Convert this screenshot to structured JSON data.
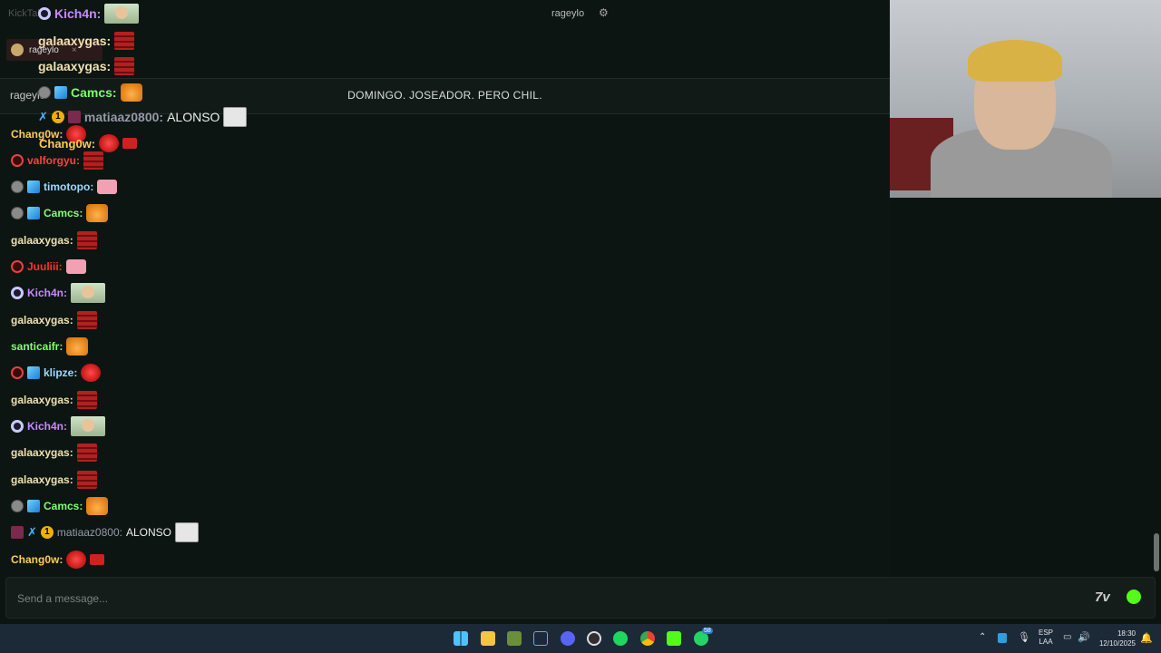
{
  "header": {
    "ghost_app": "KickTal",
    "ghost_user": "rageylo",
    "ghost_top_user": "rageylo",
    "banner_user": "rageylo",
    "pinned_message": "DOMINGO. JOSEADOR. PERO CHIL."
  },
  "overlay_rows": [
    {
      "user": "Kich4n:",
      "color": "#c989ff"
    },
    {
      "user": "galaaxygas:",
      "color": "#f0e0b0"
    },
    {
      "user": "galaaxygas:",
      "color": "#f0e0b0"
    },
    {
      "user": "Camcs:",
      "color": "#7dff6e"
    },
    {
      "user": "matiaaz0800:",
      "color": "#9999aa",
      "text": "ALONSO"
    },
    {
      "user": "Chang0w:",
      "color": "#ffcc55"
    },
    {
      "user": "Chang0w:",
      "color": "#ffcc55"
    }
  ],
  "messages": [
    {
      "user": "valforgyu:",
      "color": "#ff4040"
    },
    {
      "user": "timotopo:",
      "color": "#9fd8ff"
    },
    {
      "user": "Camcs:",
      "color": "#7dff6e"
    },
    {
      "user": "galaaxygas:",
      "color": "#f0e0b0"
    },
    {
      "user": "Juuliii:",
      "color": "#ff3030"
    },
    {
      "user": "Kich4n:",
      "color": "#c989ff"
    },
    {
      "user": "galaaxygas:",
      "color": "#f0e0b0"
    },
    {
      "user": "santicaifr:",
      "color": "#7dff6e"
    },
    {
      "user": "klipze:",
      "color": "#9fd8ff"
    },
    {
      "user": "galaaxygas:",
      "color": "#f0e0b0"
    },
    {
      "user": "Kich4n:",
      "color": "#c989ff"
    },
    {
      "user": "galaaxygas:",
      "color": "#f0e0b0"
    },
    {
      "user": "galaaxygas:",
      "color": "#f0e0b0"
    },
    {
      "user": "Camcs:",
      "color": "#7dff6e"
    },
    {
      "user": "matiaaz0800:",
      "color": "#9999aa",
      "text": "ALONSO"
    },
    {
      "user": "Chang0w:",
      "color": "#ffcc55"
    }
  ],
  "input": {
    "placeholder": "Send a message..."
  },
  "taskbar": {
    "lang_line1": "ESP",
    "lang_line2": "LAA",
    "time": "18:30",
    "date": "12/10/2025",
    "whatsapp_badge": "58"
  },
  "colors": {
    "accent_green": "#53fc18",
    "taskbar": "#1c2a38"
  }
}
